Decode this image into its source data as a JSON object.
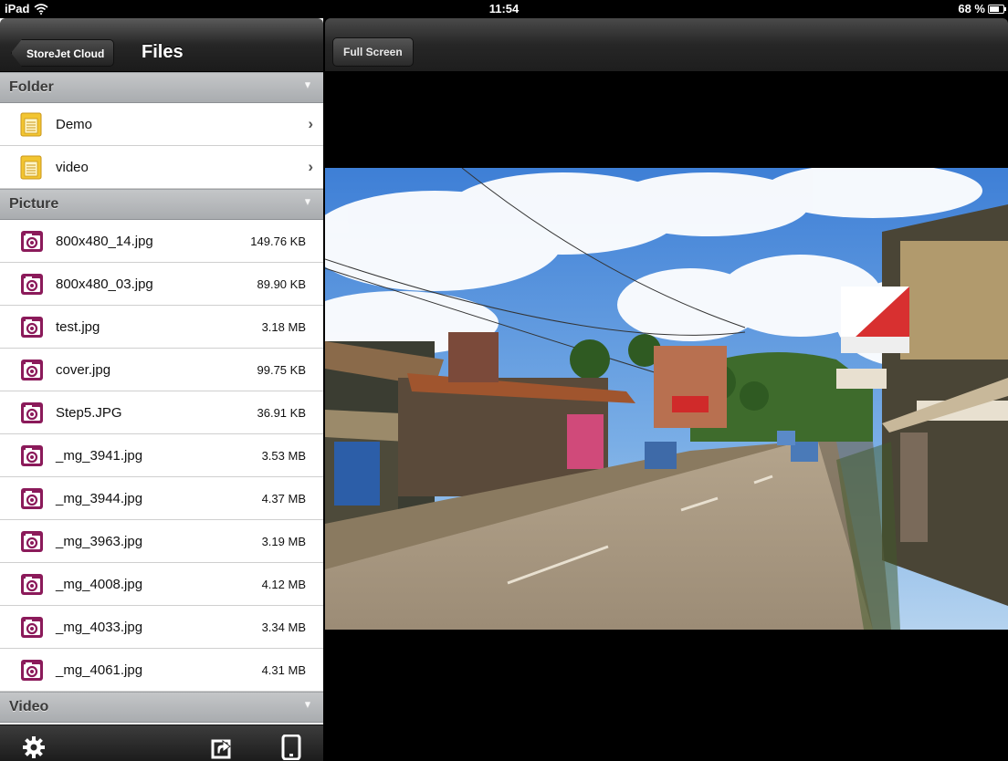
{
  "status_bar": {
    "device": "iPad",
    "time": "11:54",
    "battery": "68 %",
    "battery_level": 0.68
  },
  "left_nav": {
    "back_label": "StoreJet Cloud",
    "title": "Files"
  },
  "sections": {
    "folder": {
      "label": "Folder",
      "items": [
        {
          "name": "Demo"
        },
        {
          "name": "video"
        }
      ]
    },
    "picture": {
      "label": "Picture",
      "items": [
        {
          "name": "800x480_14.jpg",
          "size": "149.76 KB"
        },
        {
          "name": "800x480_03.jpg",
          "size": "89.90 KB"
        },
        {
          "name": "test.jpg",
          "size": "3.18 MB"
        },
        {
          "name": "cover.jpg",
          "size": "99.75 KB"
        },
        {
          "name": "Step5.JPG",
          "size": "36.91 KB"
        },
        {
          "name": "_mg_3941.jpg",
          "size": "3.53 MB"
        },
        {
          "name": "_mg_3944.jpg",
          "size": "4.37 MB"
        },
        {
          "name": "_mg_3963.jpg",
          "size": "3.19 MB"
        },
        {
          "name": "_mg_4008.jpg",
          "size": "4.12 MB"
        },
        {
          "name": "_mg_4033.jpg",
          "size": "3.34 MB"
        },
        {
          "name": "_mg_4061.jpg",
          "size": "4.31 MB"
        }
      ]
    },
    "video": {
      "label": "Video"
    }
  },
  "toolbar": {
    "icons": [
      "gear-icon",
      "share-icon",
      "device-icon"
    ]
  },
  "right_nav": {
    "fullscreen_label": "Full Screen"
  },
  "icons": {
    "folder": "folder-icon",
    "picture": "picture-icon",
    "chevron": "chevron-right-icon"
  },
  "colors": {
    "folder_icon": "#f2c531",
    "picture_icon": "#8b1a5a",
    "section_header": "#b2b4b7",
    "nav_bar": "#262626"
  }
}
